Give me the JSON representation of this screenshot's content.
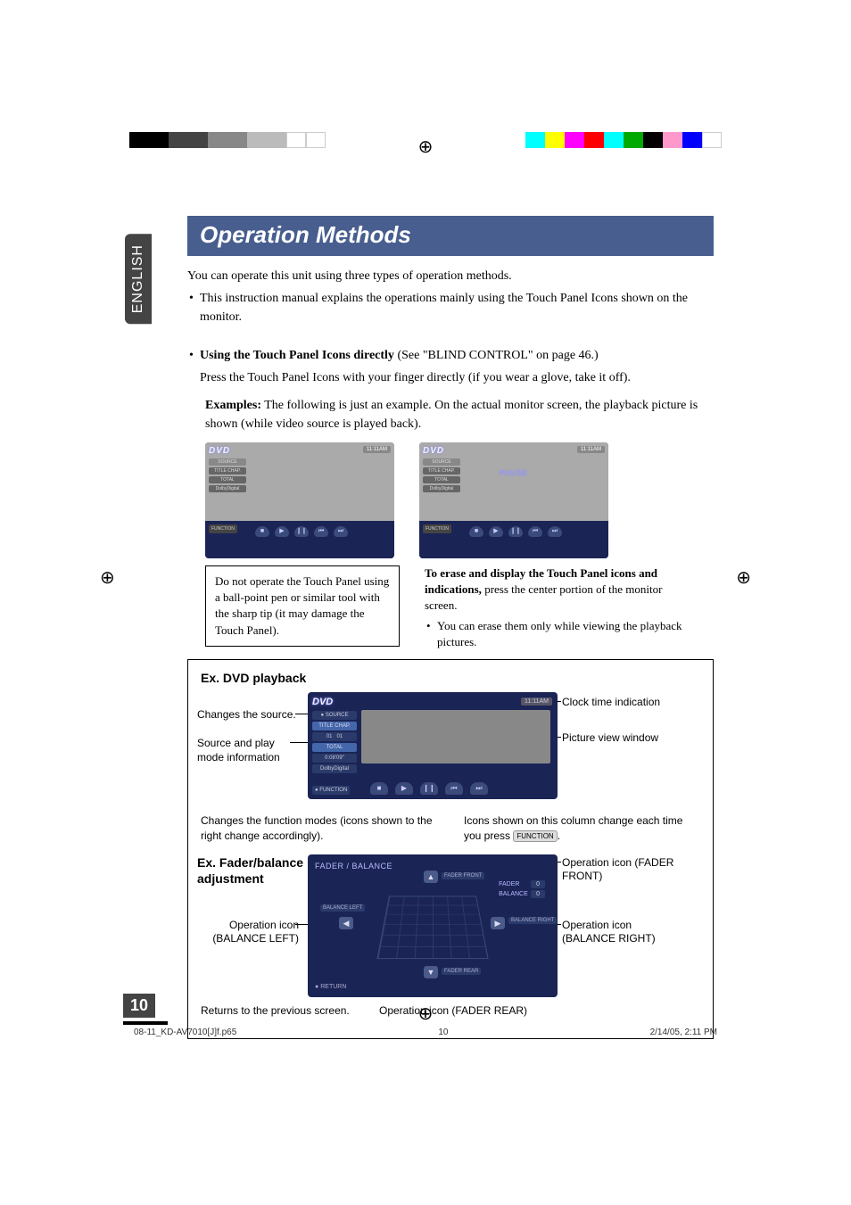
{
  "side_tab": "ENGLISH",
  "title": "Operation Methods",
  "intro": "You can operate this unit using three types of operation methods.",
  "intro_bullet": "This instruction manual explains the operations mainly using the Touch Panel Icons shown on the monitor.",
  "touch_bullet_lead": "Using the Touch Panel Icons directly",
  "touch_bullet_ref": " (See \"BLIND CONTROL\" on page 46.)",
  "touch_bullet_body": "Press the Touch Panel Icons with your finger directly (if you wear a glove, take it off).",
  "examples_lead": "Examples:",
  "examples_body": " The following is just an example. On the actual monitor screen, the playback picture is shown (while video source is played back).",
  "ss": {
    "dvd": "DVD",
    "source": "SOURCE",
    "title_chap": "TITLE CHAP.",
    "total": "TOTAL",
    "function": "FUNCTION",
    "time": "11:11AM",
    "pause": "PAUSE",
    "dolby": "DolbyDigital"
  },
  "caption_left": "Do not operate the Touch Panel using a ball-point pen or similar tool with the sharp tip (it may damage the Touch Panel).",
  "caption_right_lead": "To erase and display the Touch Panel icons and indications,",
  "caption_right_body": " press the center portion of the monitor screen.",
  "caption_right_bullet": "You can erase them only while viewing the playback pictures.",
  "ex_dvd_title": "Ex. DVD playback",
  "annots": {
    "changes_source": "Changes the source.",
    "source_play": "Source and play mode information",
    "clock": "Clock time indication",
    "picture": "Picture view window",
    "changes_function": "Changes the function modes (icons shown to the right change accordingly).",
    "icons_shown": "Icons shown on this column change each time you press ",
    "function_chip": "FUNCTION"
  },
  "ex_fader_title_line1": "Ex. Fader/balance",
  "ex_fader_title_line2": "adjustment",
  "fader": {
    "title": "FADER / BALANCE",
    "fader_front": "FADER FRONT",
    "fader_rear": "FADER REAR",
    "balance_left": "BALANCE LEFT",
    "balance_right": "BALANCE RIGHT",
    "fader_label": "FADER",
    "balance_label": "BALANCE",
    "zero": "0",
    "return": "RETURN"
  },
  "fader_annots": {
    "op_icon_front": "Operation icon (FADER FRONT)",
    "op_icon_bal_left": "Operation icon (BALANCE LEFT)",
    "op_icon_bal_right": "Operation icon (BALANCE RIGHT)",
    "returns": "Returns to the previous screen.",
    "op_rear": "Operation icon (FADER REAR)"
  },
  "page_number": "10",
  "footer": {
    "file": "08-11_KD-AV7010[J]f.p65",
    "page": "10",
    "date": "2/14/05, 2:11 PM"
  }
}
